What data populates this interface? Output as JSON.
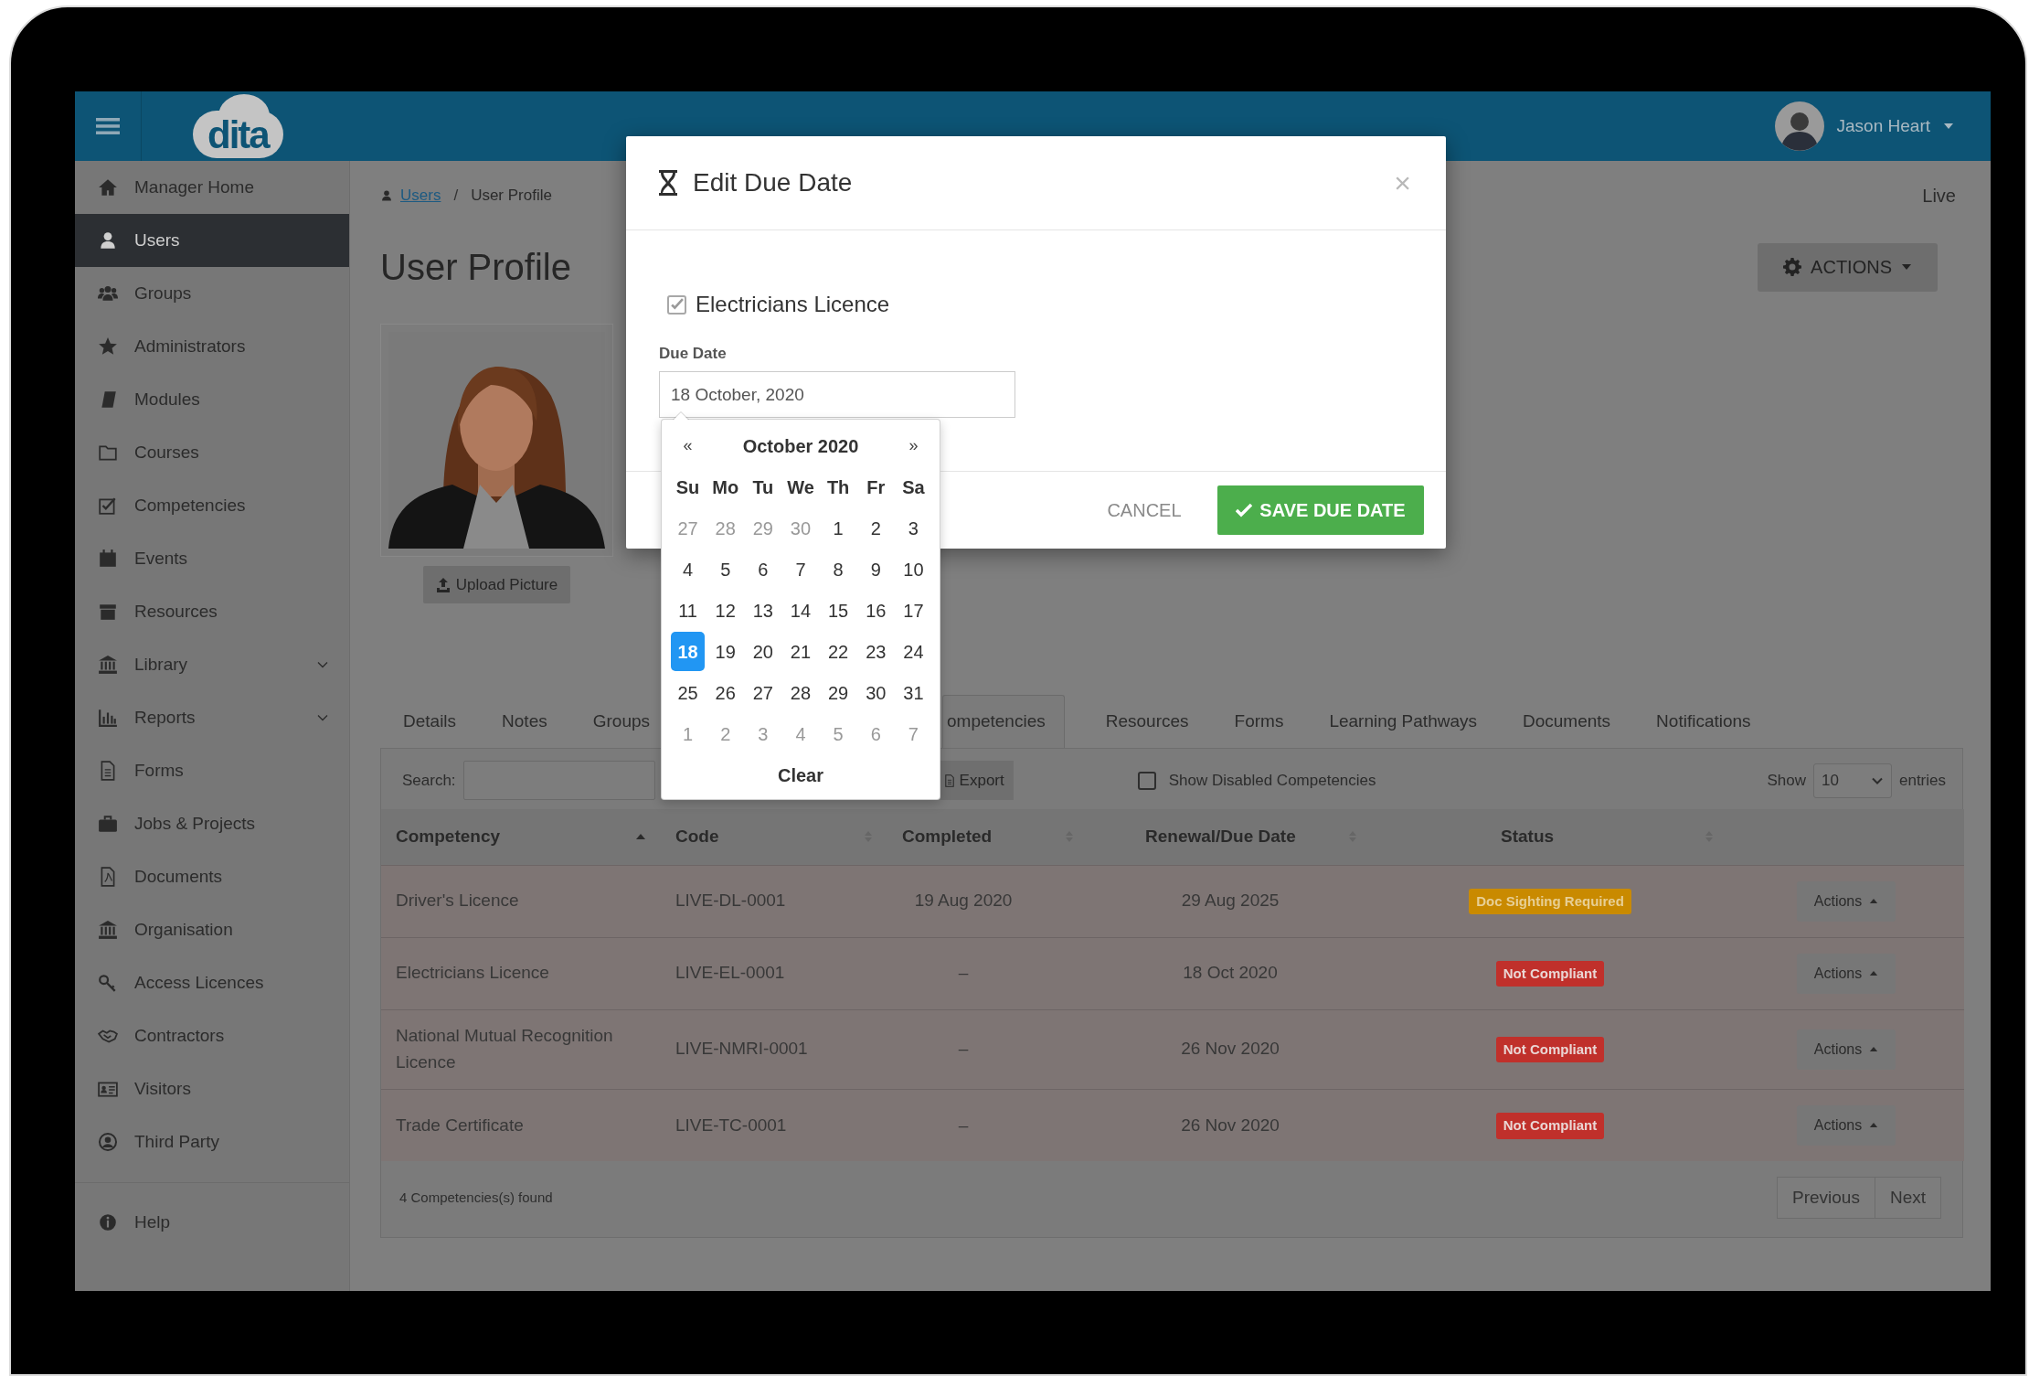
{
  "topbar": {
    "logo": "dita",
    "user_name": "Jason Heart"
  },
  "sidebar": {
    "items": [
      {
        "label": "Manager Home",
        "kind": "link",
        "selected": false
      },
      {
        "label": "Users",
        "kind": "link",
        "selected": true
      },
      {
        "label": "Groups",
        "kind": "link",
        "selected": false
      },
      {
        "label": "Administrators",
        "kind": "link",
        "selected": false
      },
      {
        "label": "Modules",
        "kind": "link",
        "selected": false
      },
      {
        "label": "Courses",
        "kind": "link",
        "selected": false
      },
      {
        "label": "Competencies",
        "kind": "link",
        "selected": false
      },
      {
        "label": "Events",
        "kind": "link",
        "selected": false
      },
      {
        "label": "Resources",
        "kind": "link",
        "selected": false
      },
      {
        "label": "Library",
        "kind": "submenu",
        "selected": false
      },
      {
        "label": "Reports",
        "kind": "submenu",
        "selected": false
      },
      {
        "label": "Forms",
        "kind": "link",
        "selected": false
      },
      {
        "label": "Jobs & Projects",
        "kind": "link",
        "selected": false
      },
      {
        "label": "Documents",
        "kind": "link",
        "selected": false
      },
      {
        "label": "Organisation",
        "kind": "link",
        "selected": false
      },
      {
        "label": "Access Licences",
        "kind": "link",
        "selected": false
      },
      {
        "label": "Contractors",
        "kind": "link",
        "selected": false
      },
      {
        "label": "Visitors",
        "kind": "link",
        "selected": false
      },
      {
        "label": "Third Party",
        "kind": "link",
        "selected": false
      }
    ],
    "footer_items": [
      {
        "label": "Help",
        "selected": false
      }
    ]
  },
  "breadcrumb": {
    "items": [
      {
        "label": "Users",
        "kind": "link"
      },
      {
        "label": "User Profile",
        "kind": "current"
      }
    ],
    "separator": "/"
  },
  "environment": "Live",
  "page_title": "User Profile",
  "actions_button": "ACTIONS",
  "upload_button": "Upload Picture",
  "tabs": [
    {
      "label": "Details",
      "selected": false
    },
    {
      "label": "Notes",
      "selected": false
    },
    {
      "label": "Groups",
      "selected": false
    },
    {
      "label": "ompetencies",
      "selected": true
    },
    {
      "label": "Resources",
      "selected": false
    },
    {
      "label": "Forms",
      "selected": false
    },
    {
      "label": "Learning Pathways",
      "selected": false
    },
    {
      "label": "Documents",
      "selected": false
    },
    {
      "label": "Notifications",
      "selected": false
    }
  ],
  "toolbar": {
    "search_label": "Search:",
    "export_button": "Export",
    "show_disabled": {
      "label": "Show Disabled Competencies",
      "checked": false
    },
    "page_size": {
      "label_before": "Show",
      "value": "10",
      "label_after": "entries"
    }
  },
  "table": {
    "columns": [
      {
        "label": "Competency",
        "sortable": true,
        "sorted_ascending": true
      },
      {
        "label": "Code",
        "sortable": true,
        "sorted_ascending": false
      },
      {
        "label": "Completed",
        "sortable": true,
        "sorted_ascending": false
      },
      {
        "label": "Renewal/Due Date",
        "sortable": true,
        "sorted_ascending": false
      },
      {
        "label": "Status",
        "sortable": true,
        "sorted_ascending": false
      }
    ],
    "rows": [
      {
        "competency": "Driver's Licence",
        "code": "LIVE-DL-0001",
        "completed": "19 Aug 2020",
        "due_date": "29 Aug 2025",
        "status": {
          "label": "Doc Sighting Required",
          "kind": "warning"
        },
        "actions": "Actions"
      },
      {
        "competency": "Electricians Licence",
        "code": "LIVE-EL-0001",
        "completed": "–",
        "due_date": "18 Oct 2020",
        "status": {
          "label": "Not Compliant",
          "kind": "danger"
        },
        "actions": "Actions"
      },
      {
        "competency": "National Mutual Recognition Licence",
        "code": "LIVE-NMRI-0001",
        "completed": "–",
        "due_date": "26 Nov 2020",
        "status": {
          "label": "Not Compliant",
          "kind": "danger"
        },
        "actions": "Actions"
      },
      {
        "competency": "Trade Certificate",
        "code": "LIVE-TC-0001",
        "completed": "–",
        "due_date": "26 Nov 2020",
        "status": {
          "label": "Not Compliant",
          "kind": "danger"
        },
        "actions": "Actions"
      }
    ]
  },
  "table_footer": {
    "summary": "4 Competencies(s) found",
    "pagination": [
      "Previous",
      "Next"
    ]
  },
  "modal": {
    "title": "Edit Due Date",
    "close": "×",
    "competency": {
      "label": "Electricians Licence",
      "checked": true,
      "disabled": true
    },
    "field_label": "Due Date",
    "field_value": "18 October, 2020",
    "buttons": [
      {
        "label": "CANCEL",
        "kind": "flat"
      },
      {
        "label": "SAVE DUE DATE",
        "kind": "primary"
      }
    ]
  },
  "datepicker": {
    "prev": "«",
    "title": "October 2020",
    "next": "»",
    "weekdays": [
      "Su",
      "Mo",
      "Tu",
      "We",
      "Th",
      "Fr",
      "Sa"
    ],
    "weeks": [
      [
        {
          "day": "27",
          "kind": "other",
          "selected": false
        },
        {
          "day": "28",
          "kind": "other",
          "selected": false
        },
        {
          "day": "29",
          "kind": "other",
          "selected": false
        },
        {
          "day": "30",
          "kind": "other",
          "selected": false
        },
        {
          "day": "1",
          "kind": "current",
          "selected": false
        },
        {
          "day": "2",
          "kind": "current",
          "selected": false
        },
        {
          "day": "3",
          "kind": "current",
          "selected": false
        }
      ],
      [
        {
          "day": "4",
          "kind": "current",
          "selected": false
        },
        {
          "day": "5",
          "kind": "current",
          "selected": false
        },
        {
          "day": "6",
          "kind": "current",
          "selected": false
        },
        {
          "day": "7",
          "kind": "current",
          "selected": false
        },
        {
          "day": "8",
          "kind": "current",
          "selected": false
        },
        {
          "day": "9",
          "kind": "current",
          "selected": false
        },
        {
          "day": "10",
          "kind": "current",
          "selected": false
        }
      ],
      [
        {
          "day": "11",
          "kind": "current",
          "selected": false
        },
        {
          "day": "12",
          "kind": "current",
          "selected": false
        },
        {
          "day": "13",
          "kind": "current",
          "selected": false
        },
        {
          "day": "14",
          "kind": "current",
          "selected": false
        },
        {
          "day": "15",
          "kind": "current",
          "selected": false
        },
        {
          "day": "16",
          "kind": "current",
          "selected": false
        },
        {
          "day": "17",
          "kind": "current",
          "selected": false
        }
      ],
      [
        {
          "day": "18",
          "kind": "current",
          "selected": true
        },
        {
          "day": "19",
          "kind": "current",
          "selected": false
        },
        {
          "day": "20",
          "kind": "current",
          "selected": false
        },
        {
          "day": "21",
          "kind": "current",
          "selected": false
        },
        {
          "day": "22",
          "kind": "current",
          "selected": false
        },
        {
          "day": "23",
          "kind": "current",
          "selected": false
        },
        {
          "day": "24",
          "kind": "current",
          "selected": false
        }
      ],
      [
        {
          "day": "25",
          "kind": "current",
          "selected": false
        },
        {
          "day": "26",
          "kind": "current",
          "selected": false
        },
        {
          "day": "27",
          "kind": "current",
          "selected": false
        },
        {
          "day": "28",
          "kind": "current",
          "selected": false
        },
        {
          "day": "29",
          "kind": "current",
          "selected": false
        },
        {
          "day": "30",
          "kind": "current",
          "selected": false
        },
        {
          "day": "31",
          "kind": "current",
          "selected": false
        }
      ],
      [
        {
          "day": "1",
          "kind": "other",
          "selected": false
        },
        {
          "day": "2",
          "kind": "other",
          "selected": false
        },
        {
          "day": "3",
          "kind": "other",
          "selected": false
        },
        {
          "day": "4",
          "kind": "other",
          "selected": false
        },
        {
          "day": "5",
          "kind": "other",
          "selected": false
        },
        {
          "day": "6",
          "kind": "other",
          "selected": false
        },
        {
          "day": "7",
          "kind": "other",
          "selected": false
        }
      ]
    ],
    "clear": "Clear"
  }
}
